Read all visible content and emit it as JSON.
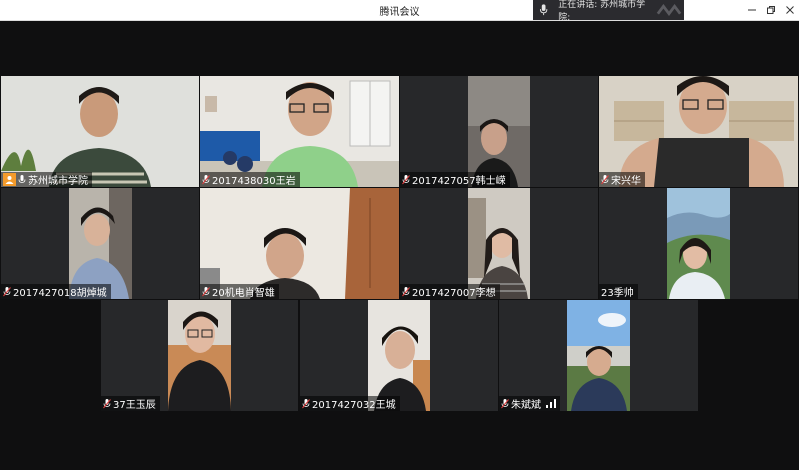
{
  "window": {
    "title": "腾讯会议",
    "speaking_label": "正在讲话: 苏州城市学院;"
  },
  "participants": [
    {
      "name": "苏州城市学院"
    },
    {
      "name": "2017438030王岩"
    },
    {
      "name": "2017427057韩士嵘"
    },
    {
      "name": "宋兴华"
    },
    {
      "name": "2017427018胡焯城"
    },
    {
      "name": "20机电肖智雄"
    },
    {
      "name": "2017427007李想"
    },
    {
      "name": "23季帅"
    },
    {
      "name": "37王玉辰"
    },
    {
      "name": "2017427032王城"
    },
    {
      "name": "朱斌斌"
    }
  ]
}
